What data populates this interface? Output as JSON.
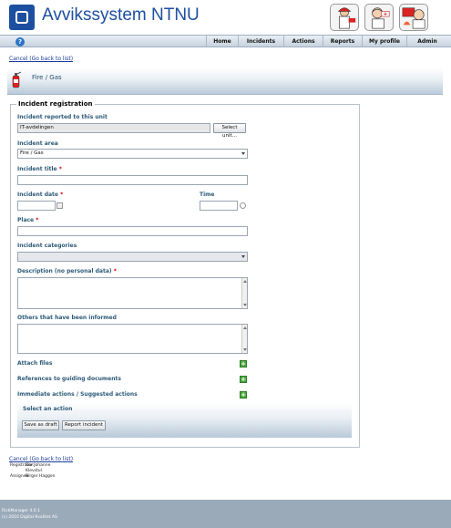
{
  "header": {
    "title": "Avvikssystem NTNU",
    "images": [
      "firefighter-image",
      "injured-person-image",
      "red-fire-image"
    ]
  },
  "nav": {
    "help_icon": "?",
    "items": [
      "Home",
      "Incidents",
      "Actions",
      "Reports",
      "My profile",
      "Admin"
    ]
  },
  "cancel_link": "Cancel (Go back to list)",
  "section": {
    "title": "Fire / Gas"
  },
  "form": {
    "legend": "Incident registration",
    "reported_unit_label": "Incident reported to this unit",
    "reported_unit_value": "IT-avdelingen",
    "select_unit_button": "Select unit...",
    "area_label": "Incident area",
    "area_value": "Fire / Gas",
    "title_label": "Incident title",
    "date_label": "Incident date",
    "time_label": "Time",
    "place_label": "Place",
    "categories_label": "Incident categories",
    "description_label": "Description (no personal data)",
    "others_label": "Others that have been informed",
    "attach_label": "Attach files",
    "references_label": "References to guiding documents",
    "immediate_label": "Immediate actions / Suggested actions",
    "required_mark": "*",
    "plus": "+"
  },
  "action": {
    "title": "Select an action",
    "save_draft": "Save as draft",
    "report": "Report incident"
  },
  "meta": {
    "rows": [
      {
        "key": "Registrator:",
        "value": "Siw Johanne"
      },
      {
        "key": "",
        "value": "Klevstul"
      },
      {
        "key": "Assignee:",
        "value": "Birger Haggen"
      }
    ]
  },
  "footer": {
    "version": "RiskManager 4.0.1",
    "copyright": "(c) 2010 Digital Kvalitet AS"
  },
  "colors": {
    "brand": "#1d4fa0",
    "label": "#2d5a78",
    "required": "#dd0000",
    "plus": "#49a83c",
    "footer": "#9aaab9"
  }
}
